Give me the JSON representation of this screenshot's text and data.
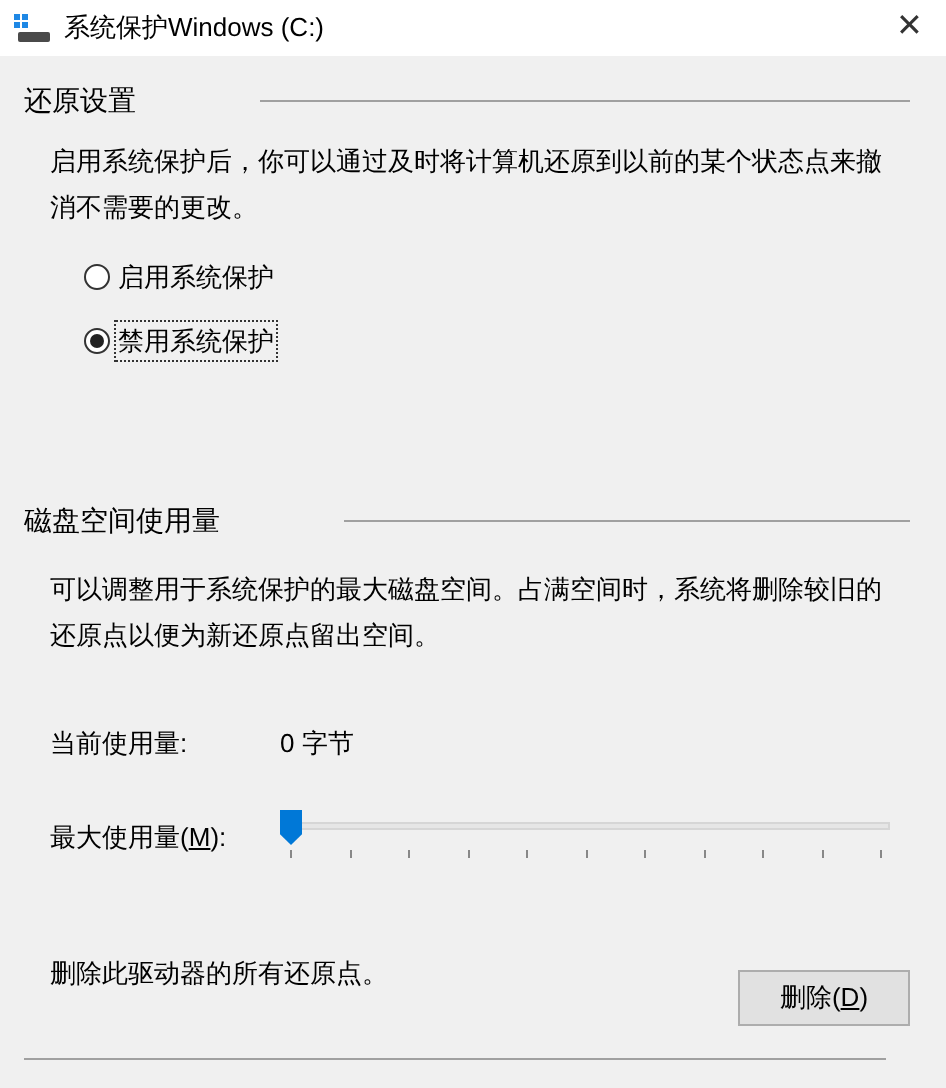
{
  "window": {
    "title": "系统保护Windows (C:)",
    "close": "✕"
  },
  "restore_settings": {
    "heading": "还原设置",
    "description": "启用系统保护后，你可以通过及时将计算机还原到以前的某个状态点来撤消不需要的更改。",
    "options": [
      {
        "label": "启用系统保护",
        "selected": false
      },
      {
        "label": "禁用系统保护",
        "selected": true
      }
    ]
  },
  "disk_usage": {
    "heading": "磁盘空间使用量",
    "description": "可以调整用于系统保护的最大磁盘空间。占满空间时，系统将删除较旧的还原点以便为新还原点留出空间。",
    "current_label": "当前使用量:",
    "current_value": "0 字节",
    "max_label": {
      "before": "最大使用量(",
      "key": "M",
      "after": "):"
    },
    "slider": {
      "level": 0
    }
  },
  "delete": {
    "text": "删除此驱动器的所有还原点。",
    "button": {
      "before": "删除(",
      "key": "D",
      "after": ")"
    }
  }
}
